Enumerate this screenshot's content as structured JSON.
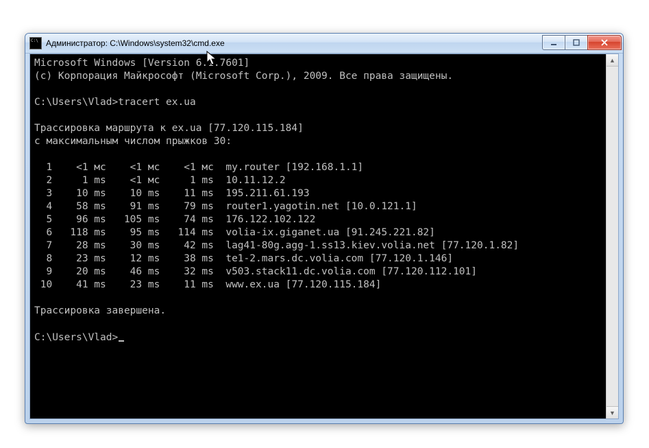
{
  "window": {
    "title_prefix": "Администратор:",
    "title_path": "C:\\Windows\\system32\\cmd.exe"
  },
  "header": {
    "line1": "Microsoft Windows [Version 6.1.7601]",
    "line2": "(c) Корпорация Майкрософт (Microsoft Corp.), 2009. Все права защищены."
  },
  "prompt1": {
    "path": "C:\\Users\\Vlad>",
    "command": "tracert ex.ua"
  },
  "trace": {
    "heading": "Трассировка маршрута к ex.ua [77.120.115.184]",
    "hops_line": "с максимальным числом прыжков 30:",
    "rows": [
      {
        "n": "1",
        "t1": "<1 мс",
        "t2": "<1 мс",
        "t3": "<1 мс",
        "host": "my.router [192.168.1.1]"
      },
      {
        "n": "2",
        "t1": "1 ms",
        "t2": "<1 мс",
        "t3": "1 ms",
        "host": "10.11.12.2"
      },
      {
        "n": "3",
        "t1": "10 ms",
        "t2": "10 ms",
        "t3": "11 ms",
        "host": "195.211.61.193"
      },
      {
        "n": "4",
        "t1": "58 ms",
        "t2": "91 ms",
        "t3": "79 ms",
        "host": "router1.yagotin.net [10.0.121.1]"
      },
      {
        "n": "5",
        "t1": "96 ms",
        "t2": "105 ms",
        "t3": "74 ms",
        "host": "176.122.102.122"
      },
      {
        "n": "6",
        "t1": "118 ms",
        "t2": "95 ms",
        "t3": "114 ms",
        "host": "volia-ix.giganet.ua [91.245.221.82]"
      },
      {
        "n": "7",
        "t1": "28 ms",
        "t2": "30 ms",
        "t3": "42 ms",
        "host": "lag41-80g.agg-1.ss13.kiev.volia.net [77.120.1.82]"
      },
      {
        "n": "8",
        "t1": "23 ms",
        "t2": "12 ms",
        "t3": "38 ms",
        "host": "te1-2.mars.dc.volia.com [77.120.1.146]"
      },
      {
        "n": "9",
        "t1": "20 ms",
        "t2": "46 ms",
        "t3": "32 ms",
        "host": "v503.stack11.dc.volia.com [77.120.112.101]"
      },
      {
        "n": "10",
        "t1": "41 ms",
        "t2": "23 ms",
        "t3": "11 ms",
        "host": "www.ex.ua [77.120.115.184]"
      }
    ],
    "done": "Трассировка завершена."
  },
  "prompt2": {
    "path": "C:\\Users\\Vlad>"
  }
}
